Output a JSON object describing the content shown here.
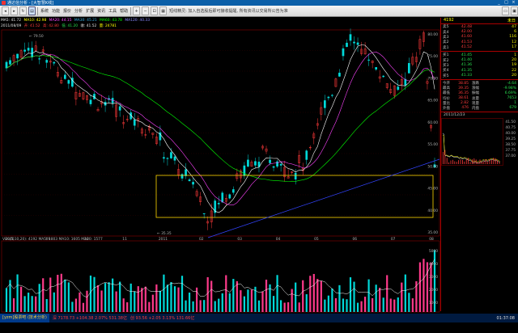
{
  "window": {
    "title": "通达信分析 - [大智慧K线]",
    "controls": [
      "_",
      "□",
      "×"
    ]
  },
  "toolbar": {
    "icons": [
      "back-icon",
      "forward-icon",
      "refresh-icon",
      "chart-icon",
      "zoom-in-icon",
      "zoom-out-icon",
      "fit-icon",
      "grid-icon",
      "layout-icon",
      "save-icon"
    ],
    "menu": [
      "系统",
      "功能",
      "报价",
      "分析",
      "扩展",
      "资讯",
      "工具",
      "帮助"
    ],
    "notice": "短线精灵: 加入自选股后即可接收提醒, 所有资讯以交易所公告为准"
  },
  "header": {
    "line1": [
      "MA5: 41.72",
      "MA10: 42.98",
      "MA20: 44.15",
      "MA30: 45.21",
      "MA60: 43.78",
      "MA120: 40.33"
    ],
    "line2": [
      "2011/08/09",
      "开: 41.52",
      "高: 42.80",
      "低: 41.20",
      "收: 41.52",
      "量: 24781"
    ]
  },
  "chart": {
    "price_labels": [
      "80.00",
      "75.00",
      "70.00",
      "65.00",
      "60.00",
      "55.00",
      "50.00",
      "45.00",
      "40.00",
      "35.00"
    ],
    "date_labels": [
      "2010",
      "09",
      "10",
      "11",
      "2011",
      "02",
      "03",
      "04",
      "05",
      "06",
      "07",
      "08"
    ],
    "annotation_high": "79.50",
    "annotation_low": "35.35",
    "volume_labels": [
      "5000",
      "4000",
      "3000",
      "2000",
      "1000"
    ],
    "volume_header": "VOL(5,10,20): 4192  MA5: 1803  MA10: 1605  MA20: 1577"
  },
  "quote": {
    "code": "4192",
    "name": "未日",
    "rows_ask": [
      {
        "label": "卖5",
        "price": "42.48",
        "vol": "47"
      },
      {
        "label": "卖4",
        "price": "42.00",
        "vol": "6"
      },
      {
        "label": "卖3",
        "price": "41.60",
        "vol": "116"
      },
      {
        "label": "卖2",
        "price": "41.53",
        "vol": "12"
      },
      {
        "label": "卖1",
        "price": "41.52",
        "vol": "17"
      }
    ],
    "rows_bid": [
      {
        "label": "买1",
        "price": "41.45",
        "vol": "1"
      },
      {
        "label": "买2",
        "price": "41.40",
        "vol": "20"
      },
      {
        "label": "买3",
        "price": "41.36",
        "vol": "19"
      },
      {
        "label": "买4",
        "price": "41.35",
        "vol": "22"
      },
      {
        "label": "买5",
        "price": "41.33",
        "vol": "20"
      }
    ],
    "stats": [
      {
        "a": "今开",
        "b": "38.85",
        "c": "涨跌",
        "d": "-4.64"
      },
      {
        "a": "最高",
        "b": "39.35",
        "c": "涨幅",
        "d": "-9.98%"
      },
      {
        "a": "最低",
        "b": "36.35",
        "c": "振幅",
        "d": "6.69%"
      },
      {
        "a": "均价",
        "b": "38.61",
        "c": "总量",
        "d": "7653"
      },
      {
        "a": "量比",
        "b": "2.82",
        "c": "现量",
        "d": "1"
      },
      {
        "a": "外盘",
        "b": "476",
        "c": "内盘",
        "d": "679"
      }
    ],
    "date": "2011/12/23",
    "side_price_labels": [
      "41.50",
      "40.75",
      "40.00",
      "39.25",
      "38.50",
      "37.75",
      "37.00"
    ]
  },
  "status": {
    "brand": "[yzm]股票吧 (技术分析)",
    "items": [
      "深 7178.73 +104.38 2.07% 531.38亿",
      "创 93.56 +2.05 3.13% 131.66亿",
      "01:37:08"
    ]
  },
  "colors": {
    "up": "#ff3a3a",
    "down": "#29e04f",
    "ma5": "#ffffff",
    "ma10": "#ffff00",
    "ma20": "#ff44ff",
    "ma60": "#00ff00",
    "box": "#ffd700"
  }
}
